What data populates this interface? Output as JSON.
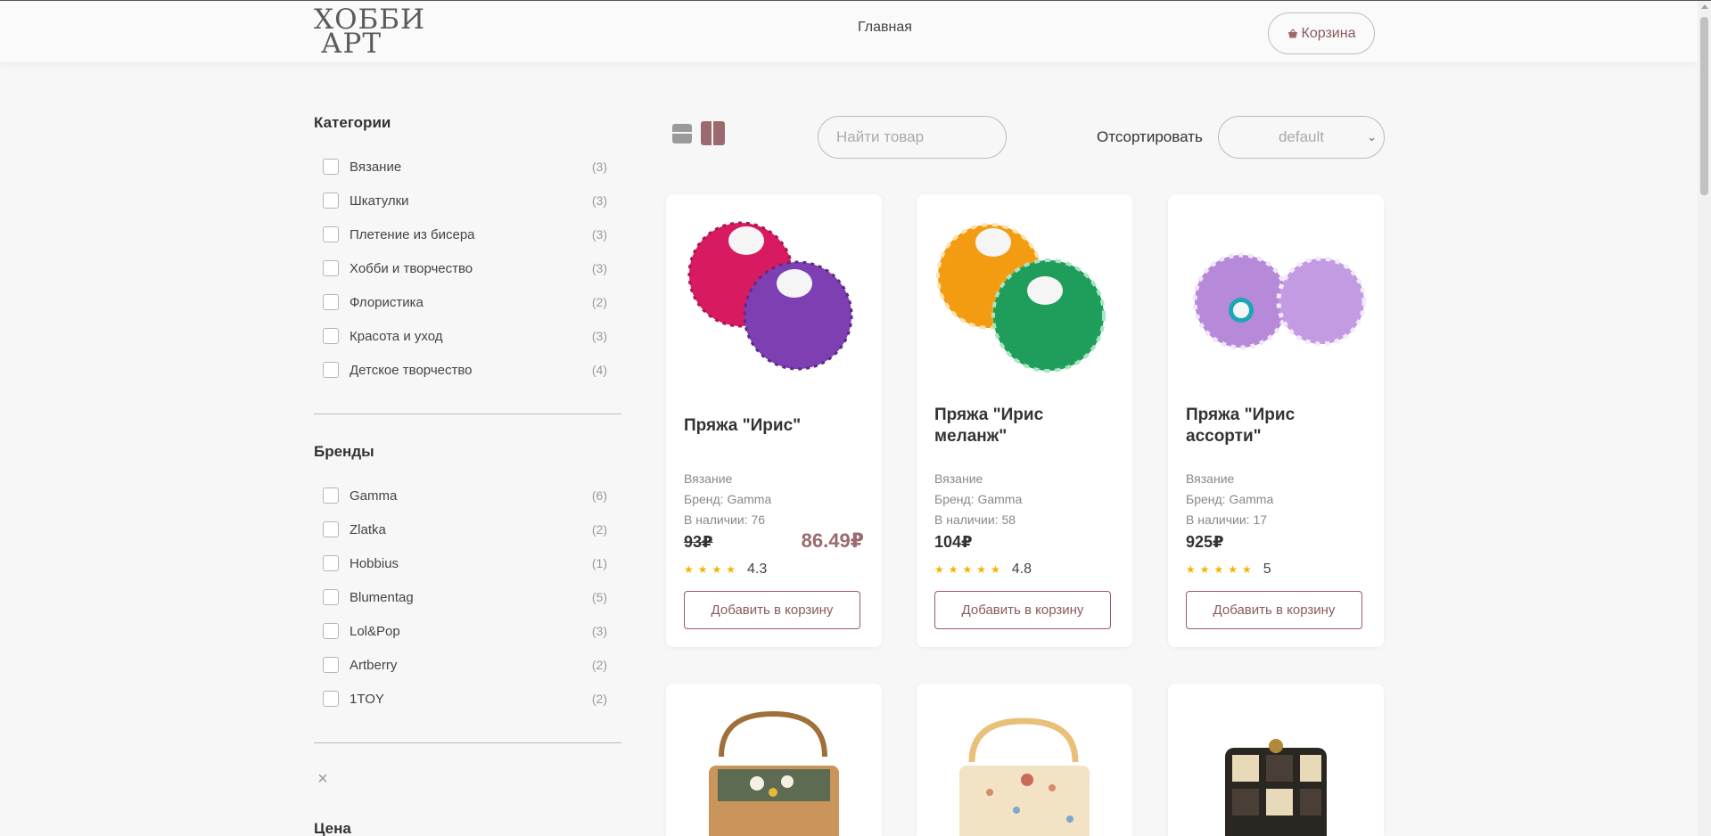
{
  "header": {
    "logo_line1": "ХОББИ",
    "logo_line2": "АРТ",
    "nav_home": "Главная",
    "cart_label": "Корзина"
  },
  "sidebar": {
    "categories_title": "Категории",
    "categories": [
      {
        "label": "Вязание",
        "count": "(3)"
      },
      {
        "label": "Шкатулки",
        "count": "(3)"
      },
      {
        "label": "Плетение из бисера",
        "count": "(3)"
      },
      {
        "label": "Хобби и творчество",
        "count": "(3)"
      },
      {
        "label": "Флористика",
        "count": "(2)"
      },
      {
        "label": "Красота и уход",
        "count": "(3)"
      },
      {
        "label": "Детское творчество",
        "count": "(4)"
      }
    ],
    "brands_title": "Бренды",
    "brands": [
      {
        "label": "Gamma",
        "count": "(6)"
      },
      {
        "label": "Zlatka",
        "count": "(2)"
      },
      {
        "label": "Hobbius",
        "count": "(1)"
      },
      {
        "label": "Blumentag",
        "count": "(5)"
      },
      {
        "label": "Lol&Pop",
        "count": "(3)"
      },
      {
        "label": "Artberry",
        "count": "(2)"
      },
      {
        "label": "1TOY",
        "count": "(2)"
      }
    ],
    "clear_icon": "×",
    "price_title": "Цена"
  },
  "toolbar": {
    "search_placeholder": "Найти товар",
    "sort_label": "Отсортировать",
    "sort_value": "default"
  },
  "products": [
    {
      "title": "Пряжа \"Ирис\"",
      "category": "Вязание",
      "brand": "Бренд: Gamma",
      "stock": "В наличии: 76",
      "price_old": "93₽",
      "price_new": "86.49₽",
      "rating": "4.3",
      "stars": "★★★★",
      "add_label": "Добавить в корзину"
    },
    {
      "title": "Пряжа \"Ирис меланж\"",
      "category": "Вязание",
      "brand": "Бренд: Gamma",
      "stock": "В наличии: 58",
      "price_old": "104₽",
      "price_new": "",
      "rating": "4.8",
      "stars": "★★★★★",
      "add_label": "Добавить в корзину"
    },
    {
      "title": "Пряжа \"Ирис ассорти\"",
      "category": "Вязание",
      "brand": "Бренд: Gamma",
      "stock": "В наличии: 17",
      "price_old": "925₽",
      "price_new": "",
      "rating": "5",
      "stars": "★★★★★",
      "add_label": "Добавить в корзину"
    }
  ],
  "colors": {
    "accent": "#9b6a6e",
    "star": "#f5b301",
    "background": "#f7f7f7"
  }
}
